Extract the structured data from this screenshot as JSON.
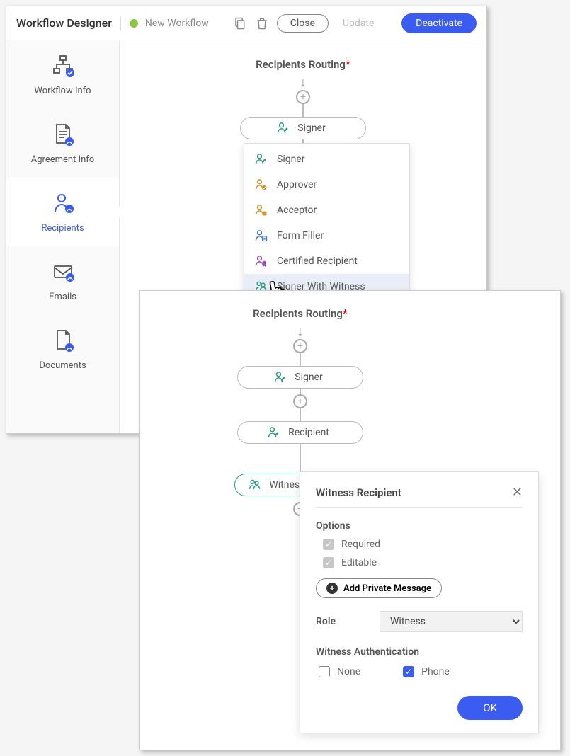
{
  "header": {
    "title": "Workflow Designer",
    "status": "New Workflow",
    "close": "Close",
    "update": "Update",
    "deactivate": "Deactivate"
  },
  "sidebar": {
    "items": [
      {
        "label": "Workflow Info"
      },
      {
        "label": "Agreement Info"
      },
      {
        "label": "Recipients"
      },
      {
        "label": "Emails"
      },
      {
        "label": "Documents"
      }
    ]
  },
  "routing": {
    "title": "Recipients Routing",
    "signer": "Signer",
    "recipient": "Recipient",
    "witness": "Witness Recipient"
  },
  "dropdown": {
    "items": [
      {
        "label": "Signer"
      },
      {
        "label": "Approver"
      },
      {
        "label": "Acceptor"
      },
      {
        "label": "Form Filler"
      },
      {
        "label": "Certified Recipient"
      },
      {
        "label": "Signer With Witness"
      }
    ]
  },
  "panel": {
    "title": "Witness Recipient",
    "options_label": "Options",
    "required": "Required",
    "editable": "Editable",
    "add_private": "Add Private Message",
    "role_label": "Role",
    "role_value": "Witness",
    "auth_label": "Witness Authentication",
    "auth_none": "None",
    "auth_phone": "Phone",
    "ok": "OK"
  }
}
